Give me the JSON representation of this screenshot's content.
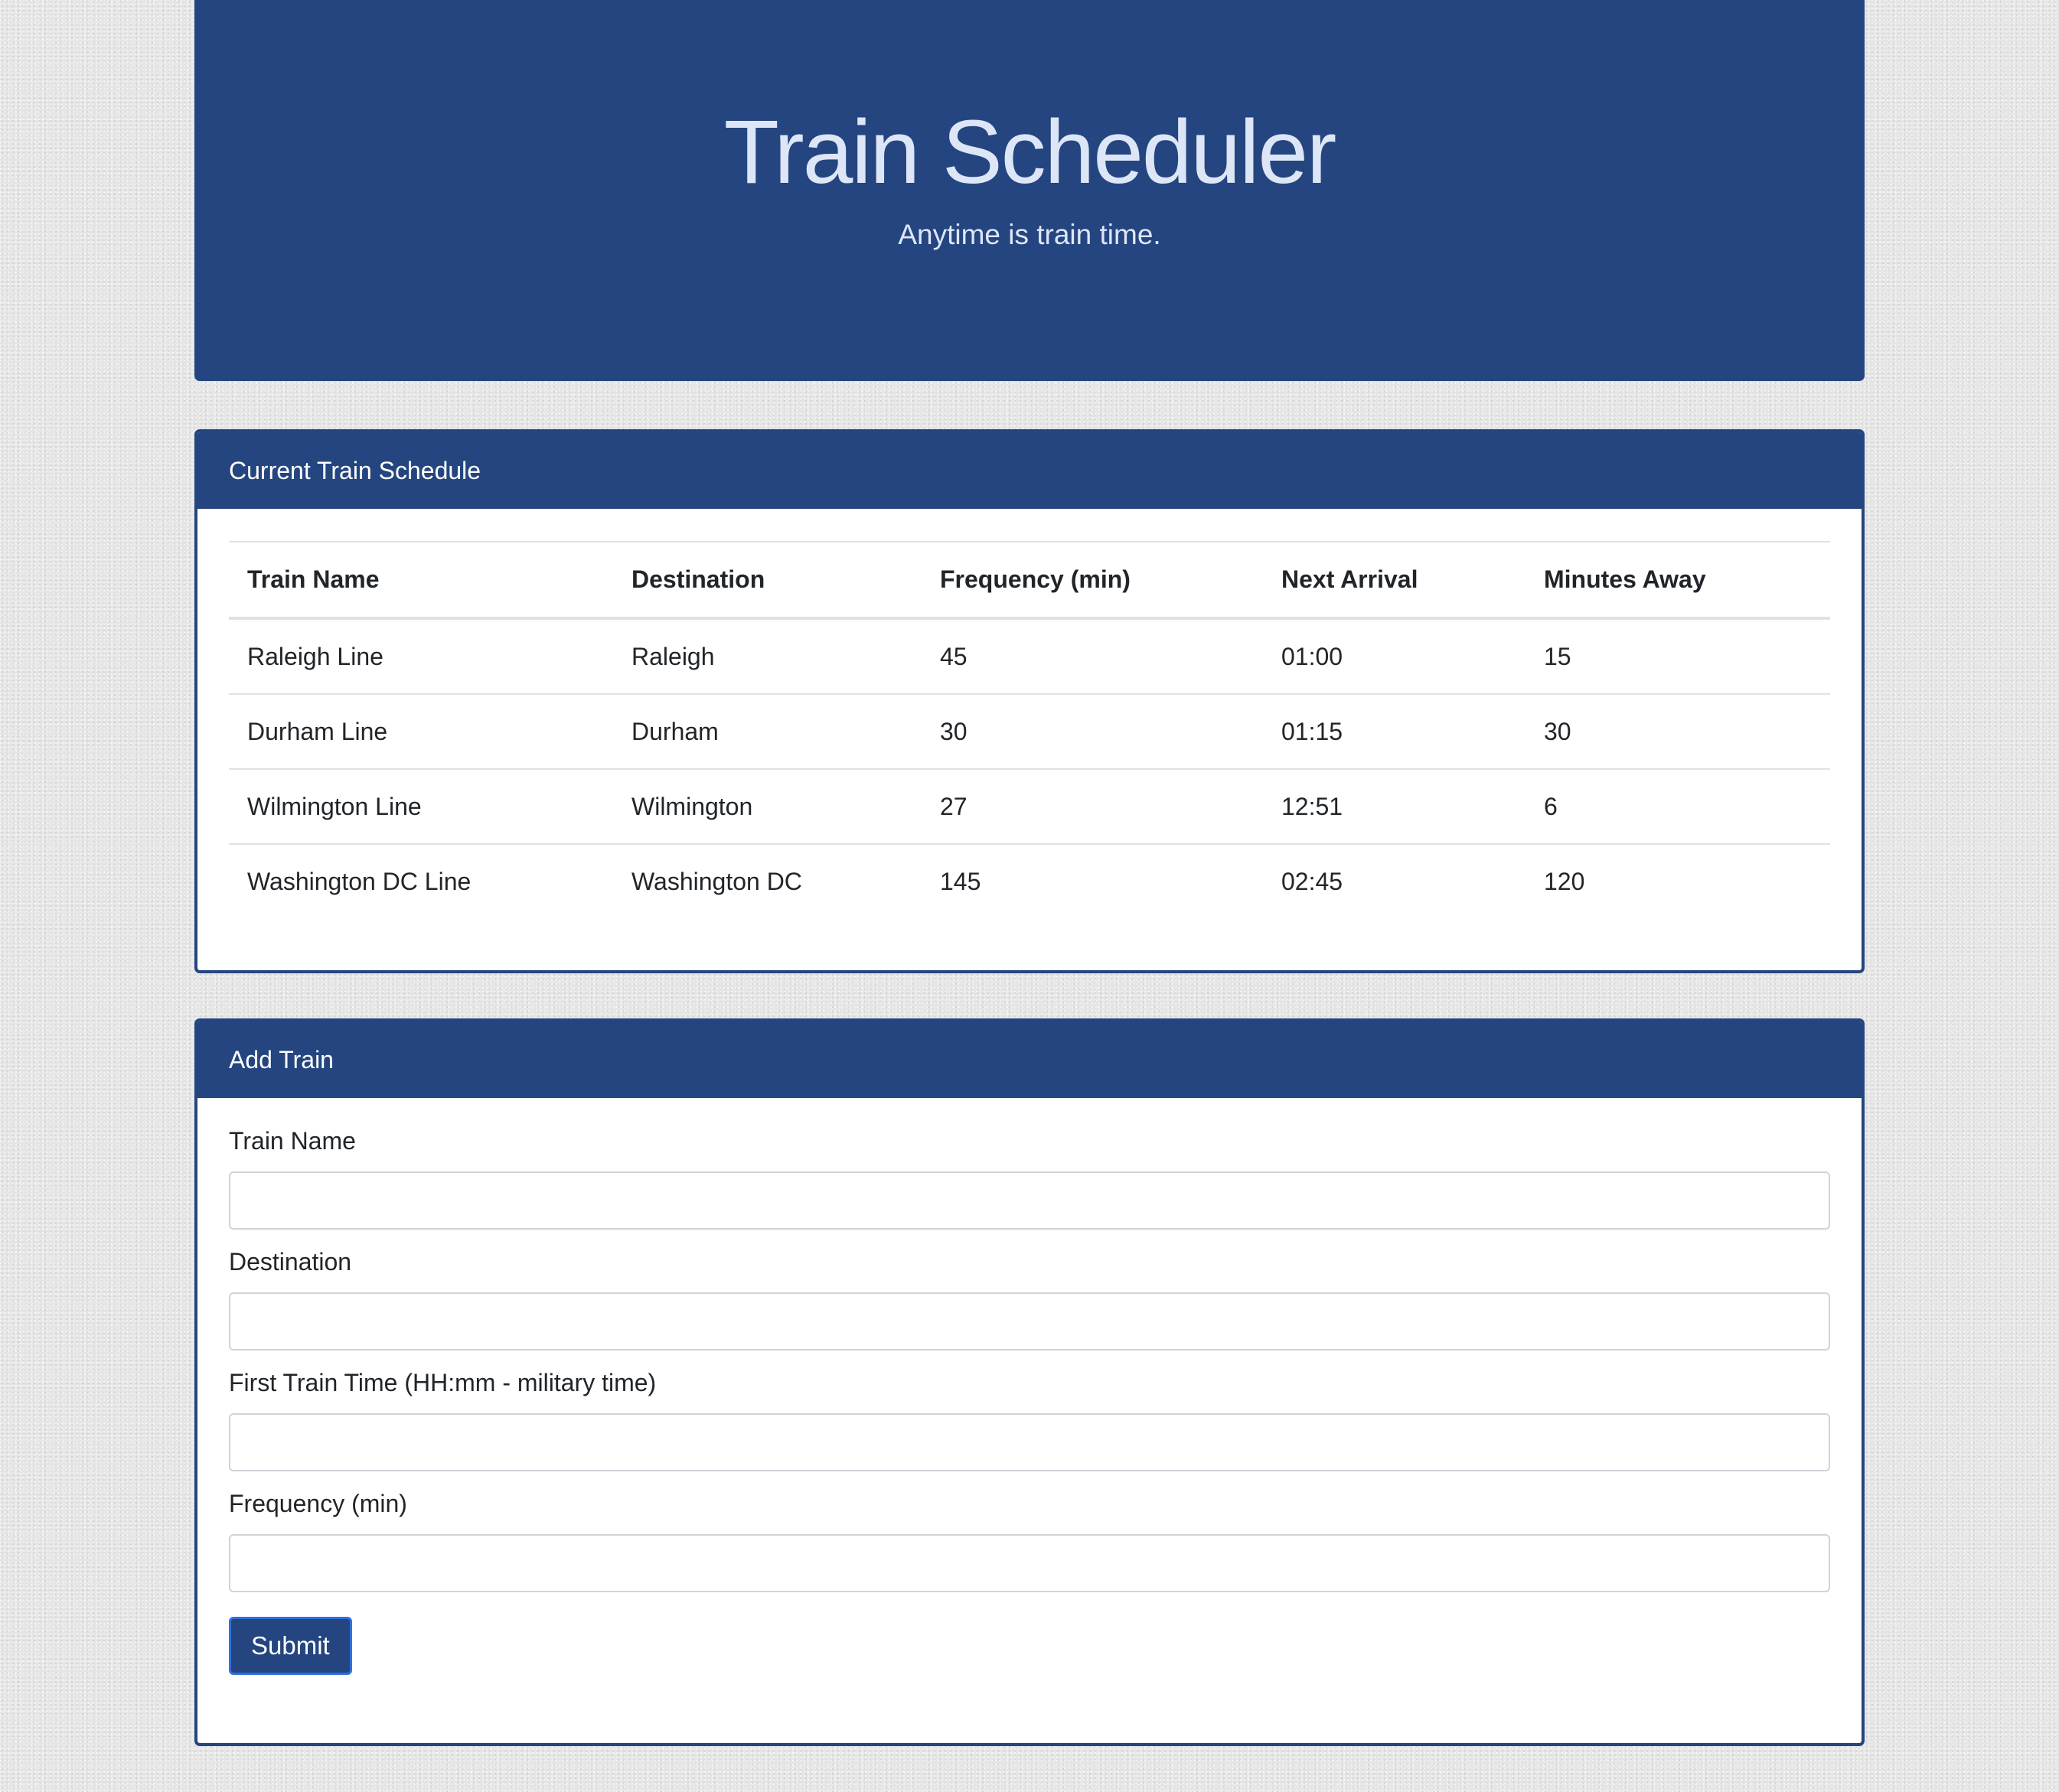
{
  "header": {
    "title": "Train Scheduler",
    "subtitle": "Anytime is train time."
  },
  "schedule": {
    "heading": "Current Train Schedule",
    "columns": [
      "Train Name",
      "Destination",
      "Frequency (min)",
      "Next Arrival",
      "Minutes Away"
    ],
    "rows": [
      [
        "Raleigh Line",
        "Raleigh",
        "45",
        "01:00",
        "15"
      ],
      [
        "Durham Line",
        "Durham",
        "30",
        "01:15",
        "30"
      ],
      [
        "Wilmington Line",
        "Wilmington",
        "27",
        "12:51",
        "6"
      ],
      [
        "Washington DC Line",
        "Washington DC",
        "145",
        "02:45",
        "120"
      ]
    ]
  },
  "add_train": {
    "heading": "Add Train",
    "fields": [
      {
        "label": "Train Name",
        "value": ""
      },
      {
        "label": "Destination",
        "value": ""
      },
      {
        "label": "First Train Time (HH:mm - military time)",
        "value": ""
      },
      {
        "label": "Frequency (min)",
        "value": ""
      }
    ],
    "submit_label": "Submit"
  },
  "colors": {
    "primary": "#24457f",
    "header_text": "#dde6f7",
    "button_border": "#2f6fe0"
  }
}
